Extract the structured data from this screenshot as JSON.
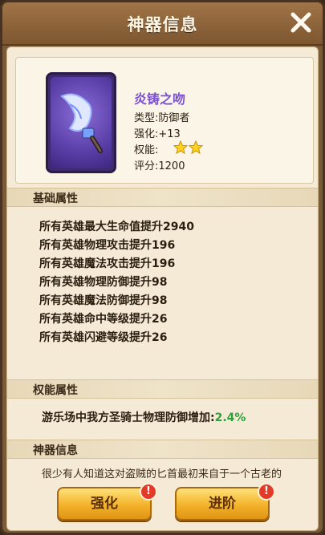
{
  "window": {
    "title": "神器信息"
  },
  "item": {
    "name": "炎铸之吻",
    "type_label": "类型:防御者",
    "enhance_label": "强化:+13",
    "skill_label": "权能:",
    "stars": 2,
    "score_label": "评分:1200"
  },
  "sections": {
    "base_title": "基础属性",
    "skill_title": "权能属性",
    "lore_title": "神器信息"
  },
  "base_attributes": [
    "所有英雄最大生命值提升2940",
    "所有英雄物理攻击提升196",
    "所有英雄魔法攻击提升196",
    "所有英雄物理防御提升98",
    "所有英雄魔法防御提升98",
    "所有英雄命中等级提升26",
    "所有英雄闪避等级提升26"
  ],
  "skill_attribute": {
    "text": "游乐场中我方圣骑士物理防御增加:",
    "value": "2.4%"
  },
  "lore": "很少有人知道这对盗贼的匕首最初来自于一个古老的",
  "buttons": {
    "enhance": "强化",
    "advance": "进阶",
    "badge": "!"
  },
  "colors": {
    "item_name": "#7a4fd0",
    "skill_value": "#2aa23a"
  }
}
